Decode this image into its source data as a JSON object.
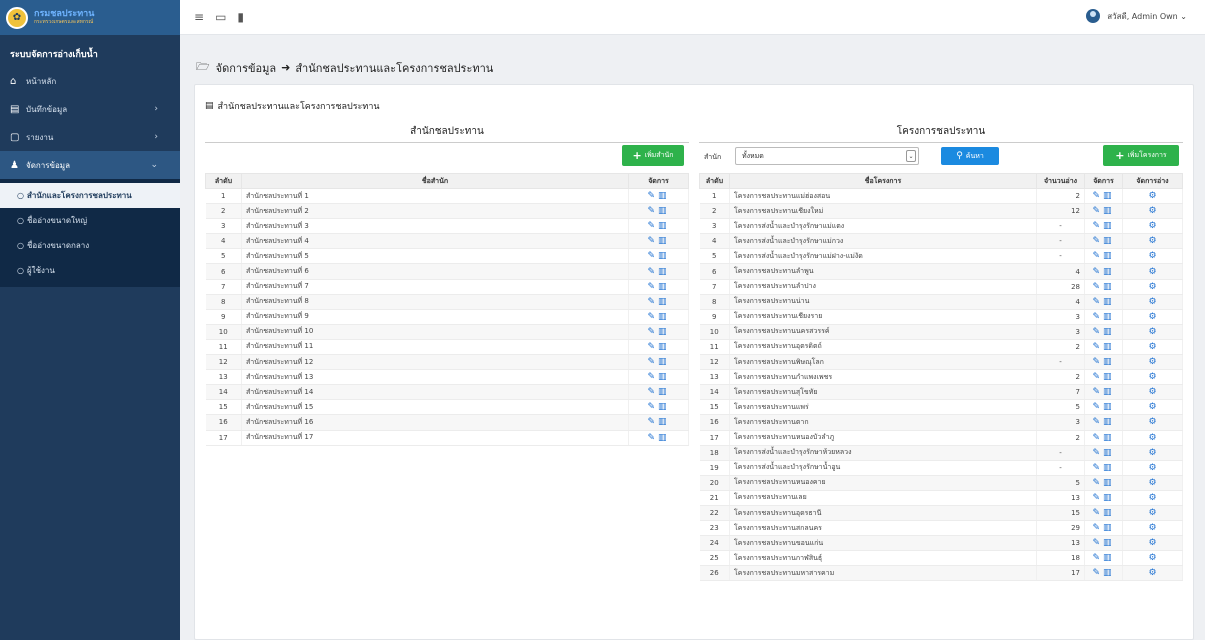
{
  "sidebar": {
    "brand_title": "กรมชลประทาน",
    "brand_sub": "กระทรวงเกษตรและสหกรณ์",
    "app_title": "ระบบจัดการอ่างเก็บน้ำ",
    "items": [
      {
        "label": "หน้าหลัก",
        "icon": "⌂"
      },
      {
        "label": "บันทึกข้อมูล",
        "icon": "▤"
      },
      {
        "label": "รายงาน",
        "icon": "▢"
      },
      {
        "label": "จัดการข้อมูล",
        "icon": "♟"
      }
    ],
    "sub_items": [
      {
        "label": "สำนักและโครงการชลประทาน"
      },
      {
        "label": "ชื่ออ่างขนาดใหญ่"
      },
      {
        "label": "ชื่ออ่างขนาดกลาง"
      },
      {
        "label": "ผู้ใช้งาน"
      }
    ]
  },
  "topbar": {
    "user_label": "สวัสดี, Admin Own ⌄"
  },
  "breadcrumb": {
    "part1": "จัดการข้อมูล",
    "arrow": "➜",
    "part2": "สำนักชลประทานและโครงการชลประทาน"
  },
  "card": {
    "title": "สำนักชลประทานและโครงการชลประทาน"
  },
  "left": {
    "title": "สำนักชลประทาน",
    "add_button": "เพิ่มสำนัก",
    "headers": [
      "ลำดับ",
      "ชื่อสำนัก",
      "จัดการ"
    ],
    "rows": [
      [
        "1",
        "สำนักชลประทานที่ 1"
      ],
      [
        "2",
        "สำนักชลประทานที่ 2"
      ],
      [
        "3",
        "สำนักชลประทานที่ 3"
      ],
      [
        "4",
        "สำนักชลประทานที่ 4"
      ],
      [
        "5",
        "สำนักชลประทานที่ 5"
      ],
      [
        "6",
        "สำนักชลประทานที่ 6"
      ],
      [
        "7",
        "สำนักชลประทานที่ 7"
      ],
      [
        "8",
        "สำนักชลประทานที่ 8"
      ],
      [
        "9",
        "สำนักชลประทานที่ 9"
      ],
      [
        "10",
        "สำนักชลประทานที่ 10"
      ],
      [
        "11",
        "สำนักชลประทานที่ 11"
      ],
      [
        "12",
        "สำนักชลประทานที่ 12"
      ],
      [
        "13",
        "สำนักชลประทานที่ 13"
      ],
      [
        "14",
        "สำนักชลประทานที่ 14"
      ],
      [
        "15",
        "สำนักชลประทานที่ 15"
      ],
      [
        "16",
        "สำนักชลประทานที่ 16"
      ],
      [
        "17",
        "สำนักชลประทานที่ 17"
      ]
    ]
  },
  "right": {
    "title": "โครงการชลประทาน",
    "filter_label": "สำนัก",
    "filter_value": "ทั้งหมด",
    "search_button": "ค้นหา",
    "add_button": "เพิ่มโครงการ",
    "headers": [
      "ลำดับ",
      "ชื่อโครงการ",
      "จำนวนอ่าง",
      "จัดการ",
      "จัดการอ่าง"
    ],
    "rows": [
      [
        "1",
        "โครงการชลประทานแม่ฮ่องสอน",
        "2"
      ],
      [
        "2",
        "โครงการชลประทานเชียงใหม่",
        "12"
      ],
      [
        "3",
        "โครงการส่งน้ำและบำรุงรักษาแม่แตง",
        "-"
      ],
      [
        "4",
        "โครงการส่งน้ำและบำรุงรักษาแม่กวง",
        "-"
      ],
      [
        "5",
        "โครงการส่งน้ำและบำรุงรักษาแม่ฝาง-แม่งัด",
        "-"
      ],
      [
        "6",
        "โครงการชลประทานลำพูน",
        "4"
      ],
      [
        "7",
        "โครงการชลประทานลำปาง",
        "28"
      ],
      [
        "8",
        "โครงการชลประทานน่าน",
        "4"
      ],
      [
        "9",
        "โครงการชลประทานเชียงราย",
        "3"
      ],
      [
        "10",
        "โครงการชลประทานนครสวรรค์",
        "3"
      ],
      [
        "11",
        "โครงการชลประทานอุตรดิตถ์",
        "2"
      ],
      [
        "12",
        "โครงการชลประทานพิษณุโลก",
        "-"
      ],
      [
        "13",
        "โครงการชลประทานกำแพงเพชร",
        "2"
      ],
      [
        "14",
        "โครงการชลประทานสุโขทัย",
        "7"
      ],
      [
        "15",
        "โครงการชลประทานแพร่",
        "5"
      ],
      [
        "16",
        "โครงการชลประทานตาก",
        "3"
      ],
      [
        "17",
        "โครงการชลประทานหนองบัวลำภู",
        "2"
      ],
      [
        "18",
        "โครงการส่งน้ำและบำรุงรักษาห้วยหลวง",
        "-"
      ],
      [
        "19",
        "โครงการส่งน้ำและบำรุงรักษาน้ำอูน",
        "-"
      ],
      [
        "20",
        "โครงการชลประทานหนองคาย",
        "5"
      ],
      [
        "21",
        "โครงการชลประทานเลย",
        "13"
      ],
      [
        "22",
        "โครงการชลประทานอุดรธานี",
        "15"
      ],
      [
        "23",
        "โครงการชลประทานสกลนคร",
        "29"
      ],
      [
        "24",
        "โครงการชลประทานขอนแก่น",
        "13"
      ],
      [
        "25",
        "โครงการชลประทานกาฬสินธุ์",
        "18"
      ],
      [
        "26",
        "โครงการชลประทานมหาสารคาม",
        "17"
      ]
    ]
  },
  "icons": {
    "edit": "pencil-icon",
    "delete": "trash-icon",
    "settings": "gear-icon"
  },
  "colors": {
    "sidebar": "#1f3b5c",
    "green": "#2eb24b",
    "blue": "#1b8ae0"
  }
}
